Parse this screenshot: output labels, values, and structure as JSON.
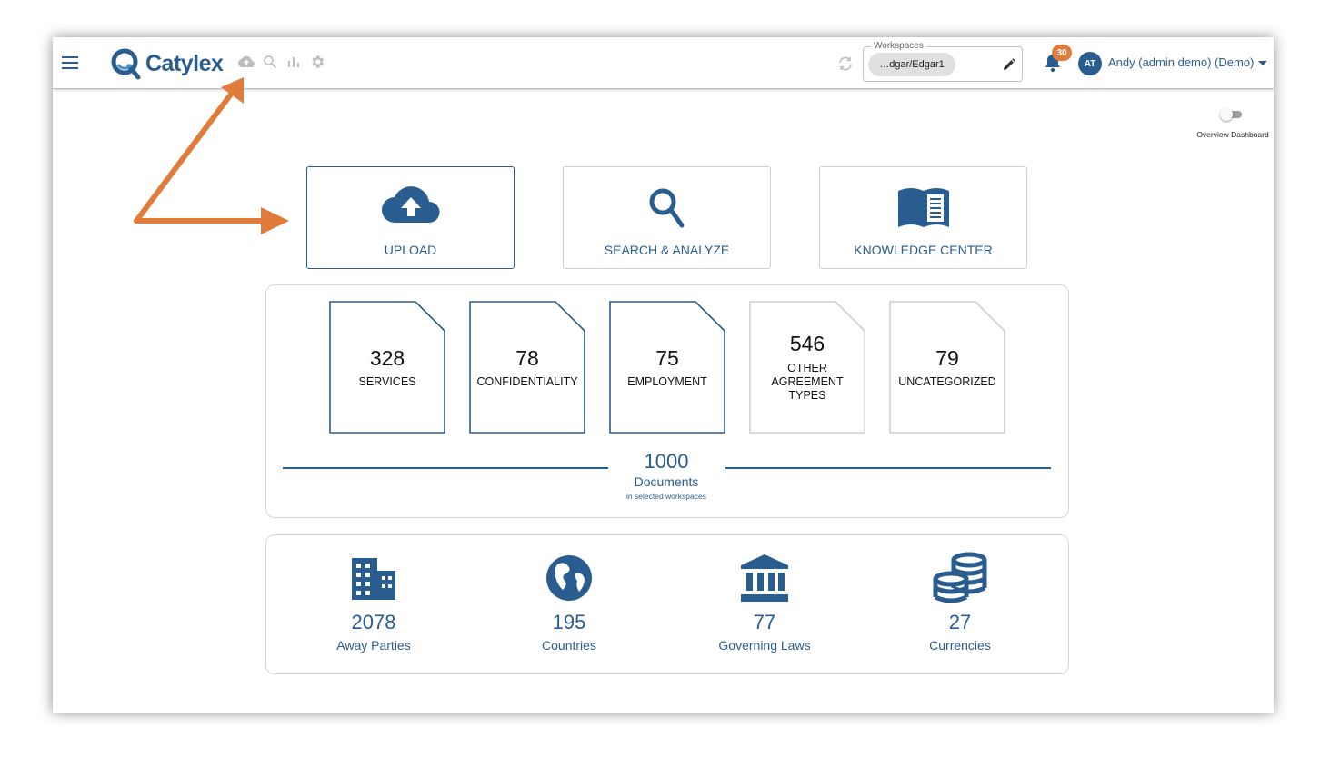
{
  "brand": {
    "logo_text": "Catylex",
    "color": "#2a5d8f",
    "accent": "#e07b39"
  },
  "toolbar": {
    "icons": [
      "upload-cloud-icon",
      "search-icon",
      "bar-chart-icon",
      "settings-gear-icon"
    ]
  },
  "workspace": {
    "label": "Workspaces",
    "value": "…dgar/Edgar1"
  },
  "notifications": {
    "count": "30"
  },
  "user": {
    "initials": "AT",
    "name": "Andy (admin demo) (Demo)"
  },
  "overview_toggle": {
    "label": "Overview Dashboard",
    "on": false
  },
  "actions": [
    {
      "label": "UPLOAD",
      "icon": "cloud-upload-icon",
      "active": true
    },
    {
      "label": "SEARCH & ANALYZE",
      "icon": "magnifier-icon",
      "active": false
    },
    {
      "label": "KNOWLEDGE CENTER",
      "icon": "book-icon",
      "active": false
    }
  ],
  "doc_types": [
    {
      "count": "328",
      "label": "SERVICES",
      "highlight": true
    },
    {
      "count": "78",
      "label": "CONFIDENTIALITY",
      "highlight": true
    },
    {
      "count": "75",
      "label": "EMPLOYMENT",
      "highlight": true
    },
    {
      "count": "546",
      "label": "OTHER AGREEMENT TYPES",
      "label_lines": [
        "OTHER",
        "AGREEMENT",
        "TYPES"
      ],
      "highlight": false
    },
    {
      "count": "79",
      "label": "UNCATEGORIZED",
      "highlight": false
    }
  ],
  "total": {
    "count": "1000",
    "label": "Documents",
    "sub": "in selected workspaces"
  },
  "stats": [
    {
      "count": "2078",
      "label": "Away Parties",
      "icon": "building-icon"
    },
    {
      "count": "195",
      "label": "Countries",
      "icon": "globe-icon"
    },
    {
      "count": "77",
      "label": "Governing Laws",
      "icon": "courthouse-icon"
    },
    {
      "count": "27",
      "label": "Currencies",
      "icon": "coins-stack-icon"
    }
  ]
}
